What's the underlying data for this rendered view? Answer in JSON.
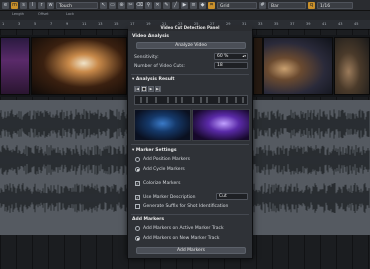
{
  "toolbar": {
    "automation_mode": "Touch",
    "grid_type": "Grid",
    "grid_unit": "Bar",
    "quantize_value": "1/16",
    "icons": [
      "e-icon",
      "m-icon",
      "s-icon",
      "l-icon",
      "r-icon",
      "w-icon",
      "arrow-icon",
      "range-icon",
      "glue-icon",
      "split-icon",
      "erase-icon",
      "zoom-icon",
      "mute-icon",
      "draw-icon",
      "line-icon",
      "play-icon",
      "comp-icon",
      "color-icon",
      "snap-icon",
      "quantize-icon"
    ]
  },
  "subbar": {
    "labels": [
      "Length",
      "Offset",
      "Lock"
    ],
    "values": [
      "",
      "",
      ""
    ]
  },
  "ruler": {
    "ticks": [
      "1",
      "3",
      "5",
      "7",
      "9",
      "11",
      "13",
      "15",
      "17",
      "19",
      "21",
      "23",
      "25",
      "27",
      "29",
      "31",
      "33",
      "35",
      "37",
      "39",
      "41",
      "43",
      "45"
    ]
  },
  "panel": {
    "title": "Video Cut Detection Panel",
    "video_analysis": {
      "heading": "Video Analysis",
      "analyze_button": "Analyze Video",
      "sensitivity_label": "Sensitivity:",
      "sensitivity_value": "60 %",
      "num_cuts_label": "Number of Video Cuts:",
      "num_cuts_value": "18"
    },
    "analysis_result": {
      "heading": "Analysis Result"
    },
    "marker_settings": {
      "heading": "Marker Settings",
      "opt_position": "Add Position Markers",
      "opt_cycle": "Add Cycle Markers",
      "colorize": "Colorize Markers",
      "use_desc": "Use Marker Description",
      "desc_value": "Cut",
      "gen_suffix": "Generate Suffix for Shot Identification"
    },
    "add_markers": {
      "heading": "Add Markers",
      "opt_active": "Add Markers on Active Marker Track",
      "opt_new": "Add Markers on New Marker Track",
      "button": "Add Markers"
    }
  },
  "colors": {
    "accent": "#c9902b",
    "panel_bg": "#2f3237",
    "wave": "#1f2226"
  }
}
